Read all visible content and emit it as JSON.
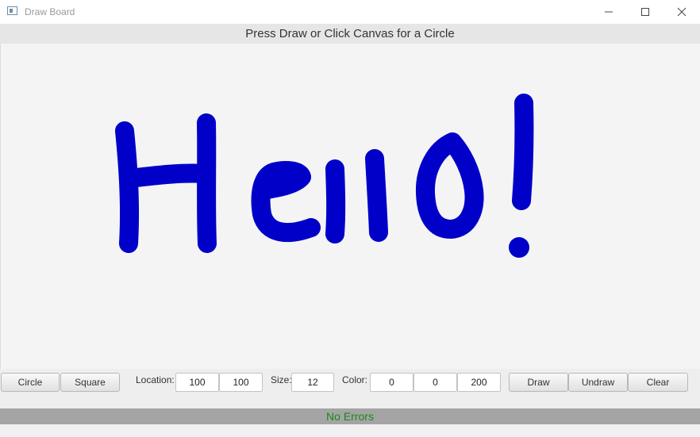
{
  "window": {
    "title": "Draw Board",
    "icon": "app-window-icon",
    "controls": [
      "minimize-icon",
      "maximize-icon",
      "close-icon"
    ]
  },
  "header": {
    "instruction": "Press Draw or Click Canvas for a Circle"
  },
  "canvas": {
    "drawing_text": "Hello!",
    "stroke_color": "#0000c8",
    "background_color": "#f4f4f4"
  },
  "toolbar": {
    "circle_label": "Circle",
    "square_label": "Square",
    "location_label": "Location:",
    "location_x": "100",
    "location_y": "100",
    "size_label": "Size:",
    "size_value": "12",
    "color_label": "Color:",
    "color_r": "0",
    "color_g": "0",
    "color_b": "200",
    "draw_label": "Draw",
    "undraw_label": "Undraw",
    "clear_label": "Clear"
  },
  "status": {
    "message": "No Errors",
    "message_color": "#1a8a1a",
    "bar_color": "#a4a4a4"
  }
}
